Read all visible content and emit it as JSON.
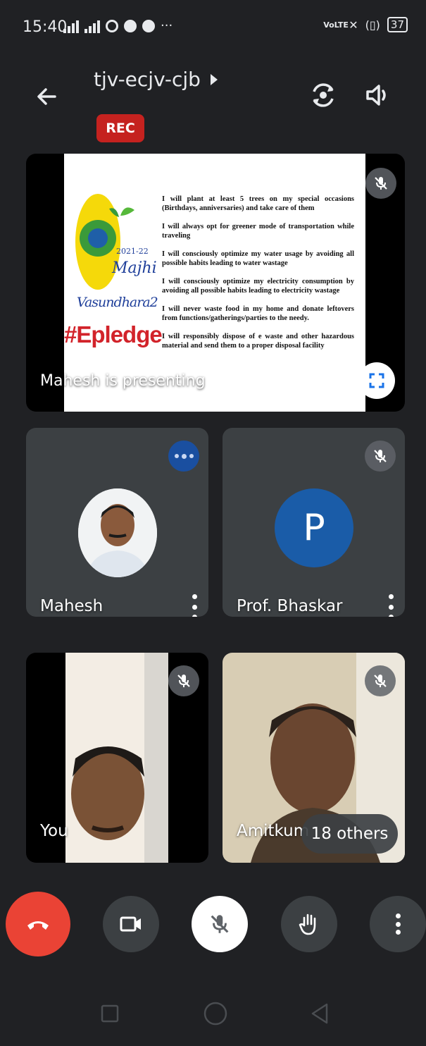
{
  "status_bar": {
    "time": "15:40",
    "battery": "37",
    "network": "VoLTE"
  },
  "header": {
    "meeting_code": "tjv-ecjv-cjb",
    "rec_label": "REC"
  },
  "presentation": {
    "slide": {
      "logo_year": "2021-22",
      "logo_title_1": "Majhi",
      "logo_title_2": "Vasundhara2",
      "hashtag": "#Epledge",
      "pledges": [
        "I will plant at least 5 trees on my special occasions (Birthdays, anniversaries) and take care of them",
        "I will always opt for greener mode of transportation while traveling",
        "I will consciously optimize my water usage by avoiding all possible habits leading to water wastage",
        "I will consciously optimize my electricity consumption by avoiding all possible habits leading to electricity wastage",
        "I will never waste food in my home and donate leftovers from functions/gatherings/parties to the needy.",
        "I will responsibly dispose of e waste and other hazardous material and send them to a proper disposal facility"
      ]
    },
    "presenter_label": "Mahesh is presenting"
  },
  "participants": [
    {
      "name": "Mahesh"
    },
    {
      "name": "Prof. Bhaskar",
      "initial": "P",
      "avatar_color": "#1a5ca8"
    },
    {
      "name": "You"
    },
    {
      "name": "Amitkum"
    }
  ],
  "others_label": "18 others",
  "colors": {
    "background": "#202124",
    "tile": "#3c4043",
    "rec": "#c5221f",
    "end_call": "#ea4335",
    "speaking": "#1a4fa0"
  }
}
